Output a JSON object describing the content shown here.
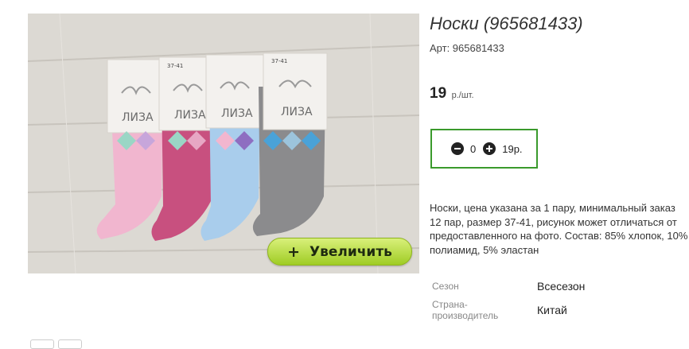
{
  "product": {
    "title": "Носки (965681433)",
    "sku": "Арт: 965681433",
    "price_value": "19",
    "price_unit": "р./шт.",
    "description": "Носки, цена указана за 1 пару, минимальный заказ 12 пар, размер 37-41, рисунок может отличаться от предоставленного на фото. Состав: 85% хлопок, 10% полиамид, 5% эластан"
  },
  "image": {
    "zoom_label": "Увеличить",
    "zoom_icon": "+",
    "brand_text": "ЛИЗА",
    "label_size": "37-41"
  },
  "quantity": {
    "value": "0",
    "total": "19р."
  },
  "specs": {
    "season_label": "Сезон",
    "season_value": "Всесезон",
    "country_label_1": "Страна-",
    "country_label_2": "производитель",
    "country_value": "Китай"
  },
  "colors": {
    "accent_green": "#3a9a2c",
    "button_green": "#b6dd3c"
  }
}
